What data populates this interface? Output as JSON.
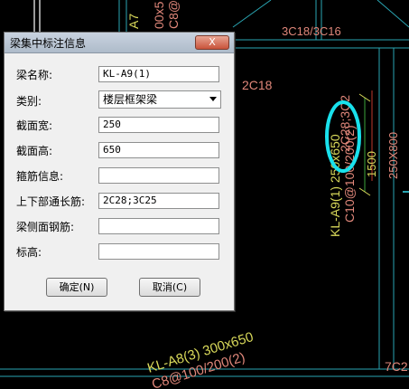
{
  "dialog": {
    "title": "梁集中标注信息",
    "close_symbol": "X",
    "fields": {
      "name": {
        "label": "梁名称:",
        "value": "KL-A9(1)"
      },
      "category": {
        "label": "类别:",
        "value": "楼层框架梁"
      },
      "width": {
        "label": "截面宽:",
        "value": "250"
      },
      "height": {
        "label": "截面高:",
        "value": "650"
      },
      "stirrup": {
        "label": "箍筋信息:",
        "value": ""
      },
      "long_bars": {
        "label": "上下部通长筋:",
        "value": "2C28;3C25"
      },
      "side_bars": {
        "label": "梁侧面钢筋:",
        "value": ""
      },
      "elevation": {
        "label": "标高:",
        "value": ""
      }
    },
    "ok_label": "确定(N)",
    "cancel_label": "取消(C)"
  },
  "drawing": {
    "labels": {
      "a7_vertical": "A7",
      "c8_top": "C8@",
      "c500_top": "00x5",
      "top_right": "3C18/3C16",
      "mid_left": "2C18",
      "kla9": "KL-A9(1) 250x650",
      "c10": "C10@100/200(2)",
      "c8_mid": "C8@",
      "ann_highlight": "2C28;3C2",
      "dim_1500": "1500",
      "dim_250x800": "250X800",
      "kla8": "KL-A8(3) 300x650",
      "c8_bottom": "C8@100/200(2)",
      "bottom_right": "7C2"
    },
    "colors": {
      "background": "#000000",
      "beam_text_yellow": "#d9d95a",
      "rebar_text_salmon": "#e0877a",
      "line_cyan": "#2aa6b3",
      "highlight_cyan": "#19e1ec",
      "grid_red": "#c0392b",
      "dim_green": "#3ca63c"
    }
  }
}
